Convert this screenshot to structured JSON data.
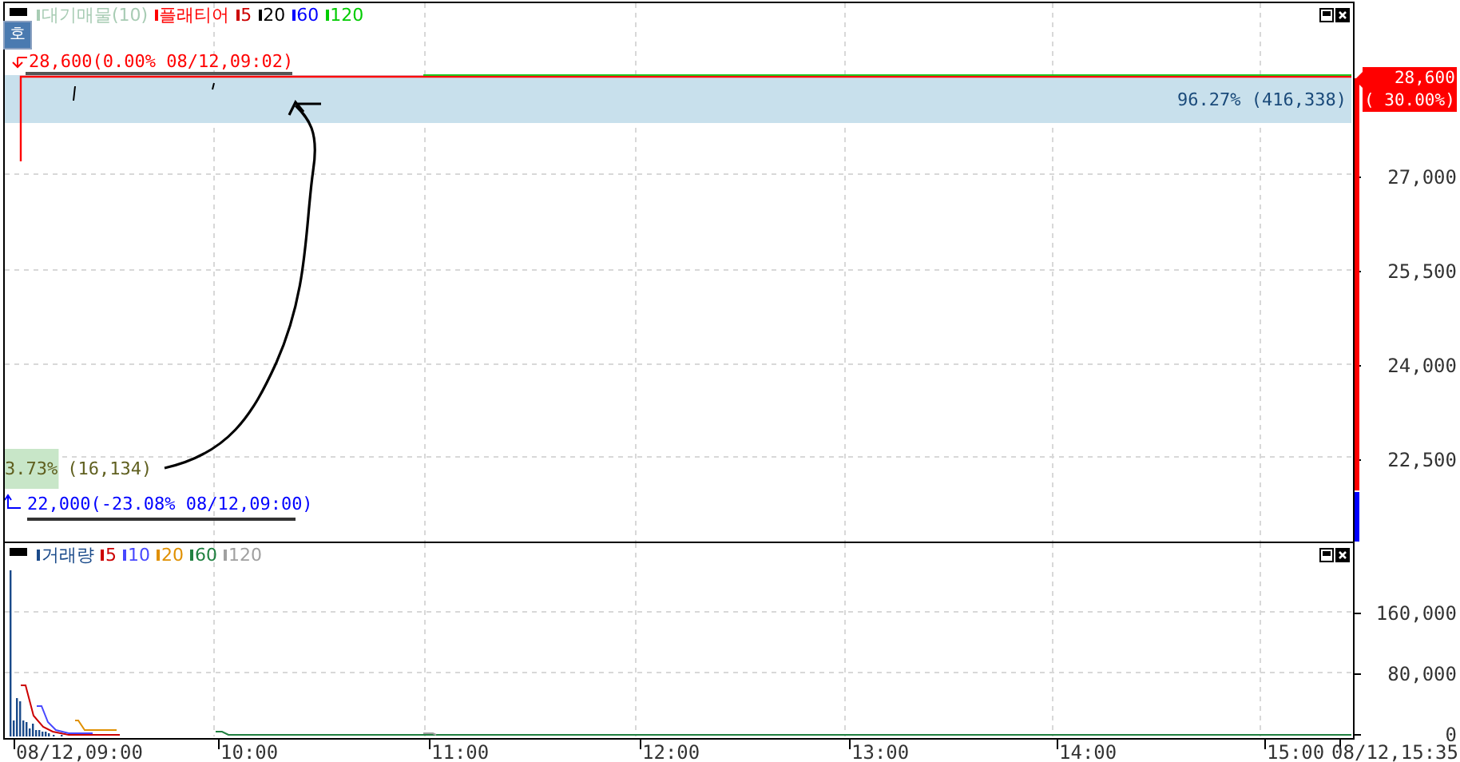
{
  "price_panel": {
    "legend": [
      {
        "label": "대기매물(10)",
        "color": "#a8ccb4"
      },
      {
        "label": "플래티어",
        "color": "#ff0000"
      },
      {
        "label": "5",
        "color": "#cc0000"
      },
      {
        "label": "20",
        "color": "#000000"
      },
      {
        "label": "60",
        "color": "#0000ff"
      },
      {
        "label": "120",
        "color": "#00cc00"
      }
    ],
    "order_button": "호",
    "high_label": "28,600(0.00% 08/12,09:02)",
    "low_label": "22,000(-23.08% 08/12,09:00)",
    "bands": [
      {
        "kind": "top",
        "label": "96.27% (416,338)",
        "level": 1
      },
      {
        "kind": "bottom",
        "label": "3.73%",
        "note": "(16,134)",
        "level": 0.04
      }
    ],
    "axis_labels": [
      "27,000",
      "25,500",
      "24,000",
      "22,500"
    ],
    "current_price": {
      "price": "28,600",
      "change": "( 30.00%)"
    }
  },
  "volume_panel": {
    "legend": [
      {
        "label": "거래량",
        "color": "#1a4a8a"
      },
      {
        "label": "5",
        "color": "#cc0000"
      },
      {
        "label": "10",
        "color": "#4848ff"
      },
      {
        "label": "20",
        "color": "#e09000"
      },
      {
        "label": "60",
        "color": "#208040"
      },
      {
        "label": "120",
        "color": "#a0a0a0"
      }
    ],
    "axis_labels": [
      "160,000",
      "80,000",
      "0"
    ]
  },
  "time_axis": [
    "08/12,09:00",
    "10:00",
    "11:00",
    "12:00",
    "13:00",
    "14:00",
    "15:00",
    "08/12,15:35"
  ]
}
